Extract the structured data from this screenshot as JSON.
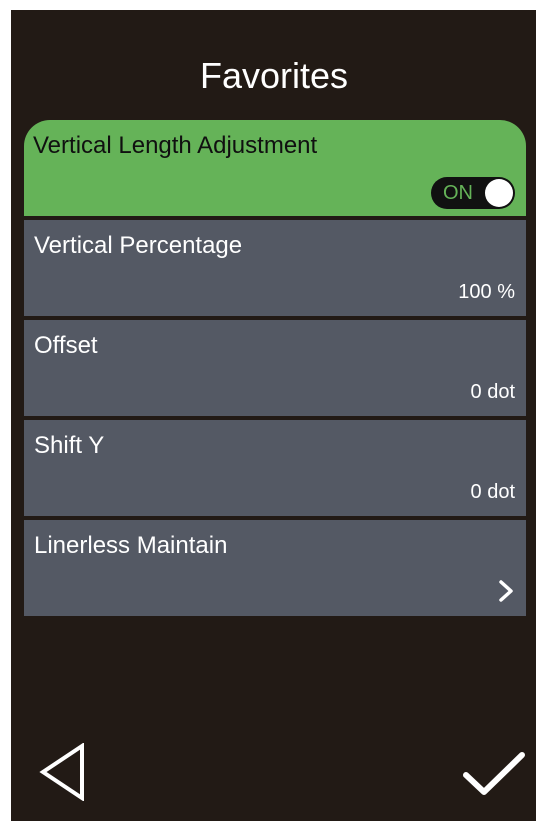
{
  "header": {
    "title": "Favorites"
  },
  "colors": {
    "screen_background": "#221a15",
    "item_background": "#545964",
    "active_background": "#65b358",
    "text_primary": "#ffffff"
  },
  "items": [
    {
      "label": "Vertical Length Adjustment",
      "control": "toggle",
      "toggle_label": "ON",
      "toggle_state": true,
      "active": true
    },
    {
      "label": "Vertical Percentage",
      "value": "100 %"
    },
    {
      "label": "Offset",
      "value": "0 dot"
    },
    {
      "label": "Shift Y",
      "value": "0 dot"
    },
    {
      "label": "Linerless Maintain",
      "control": "chevron",
      "icon": "chevron-right-icon"
    }
  ],
  "footer": {
    "back_icon": "back-triangle-icon",
    "confirm_icon": "checkmark-icon"
  }
}
